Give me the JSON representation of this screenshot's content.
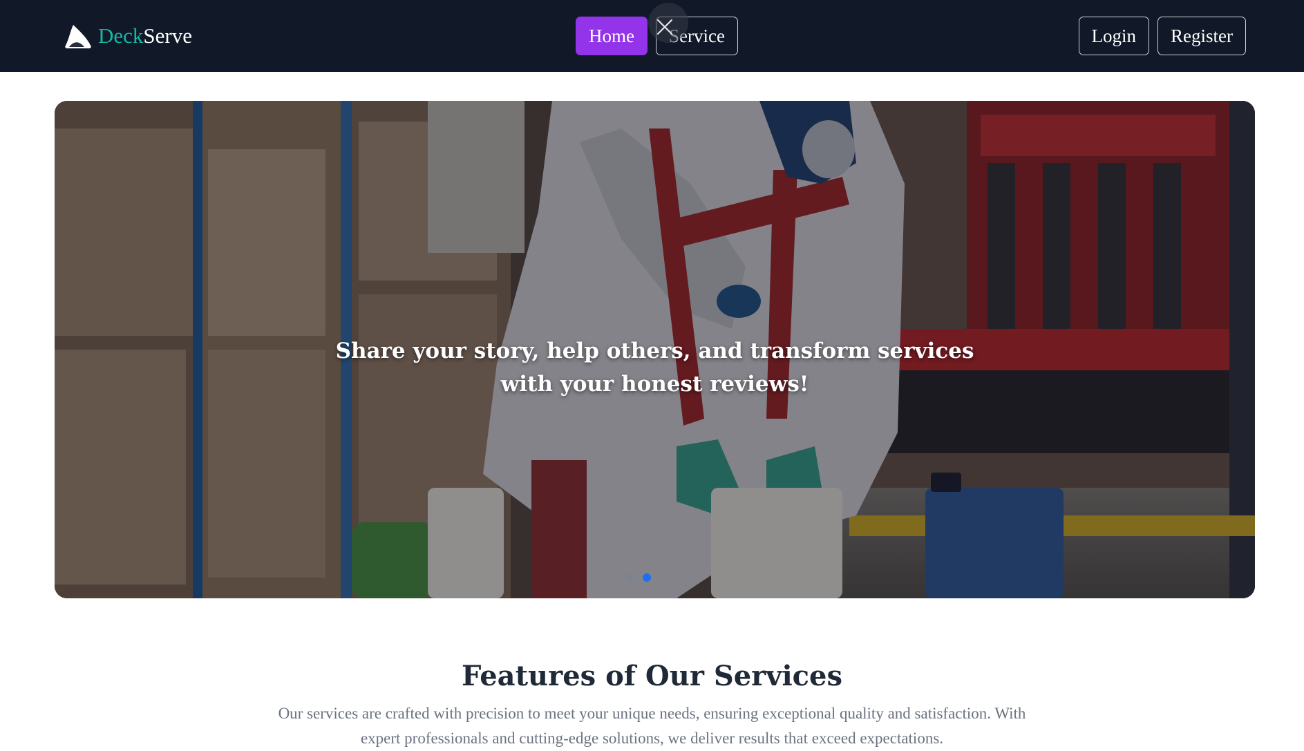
{
  "brand": {
    "part1": "Deck",
    "part2": "Serve",
    "icon": "shark-fin-logo"
  },
  "nav": {
    "home_label": "Home",
    "service_label": "Service",
    "login_label": "Login",
    "register_label": "Register"
  },
  "overlay": {
    "icon": "close-icon"
  },
  "hero": {
    "line1": "Share your story, help others, and transform services",
    "line2": "with your honest reviews!",
    "slides_total": 2,
    "active_slide": 2
  },
  "features": {
    "title": "Features of Our Services",
    "description": "Our services are crafted with precision to meet your unique needs, ensuring exceptional quality and satisfaction. With expert professionals and cutting-edge solutions, we deliver results that exceed expectations."
  },
  "colors": {
    "navbar_bg": "#111827",
    "brand_accent": "#14b8a6",
    "active_nav": "#9333ea",
    "carousel_active_dot": "#1d6ff2"
  }
}
